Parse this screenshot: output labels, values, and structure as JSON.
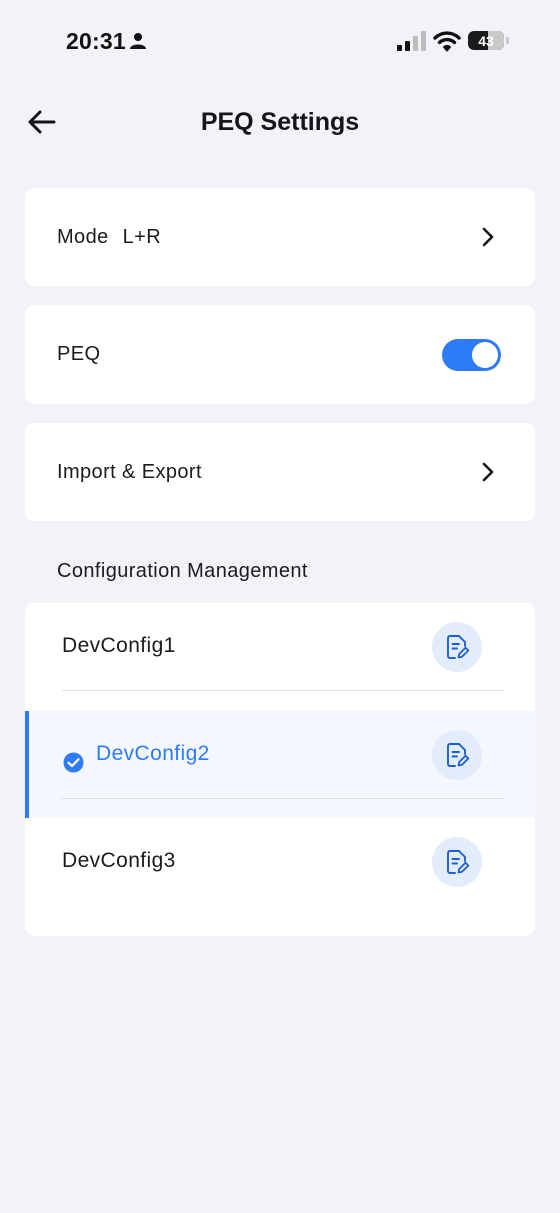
{
  "status_bar": {
    "time": "20:31",
    "battery": "43",
    "icons": [
      "person-icon",
      "signal-icon",
      "wifi-icon",
      "battery-icon"
    ]
  },
  "header": {
    "title": "PEQ Settings",
    "back_icon": "arrow-left-icon"
  },
  "mode_row": {
    "label": "Mode",
    "value": "L+R"
  },
  "peq_row": {
    "label": "PEQ",
    "enabled": true
  },
  "import_row": {
    "label": "Import & Export"
  },
  "config_section": {
    "title": "Configuration Management",
    "items": [
      {
        "name": "DevConfig1",
        "selected": false
      },
      {
        "name": "DevConfig2",
        "selected": true
      },
      {
        "name": "DevConfig3",
        "selected": false
      }
    ]
  },
  "colors": {
    "accent": "#2D7CF6",
    "background": "#F1F3F8",
    "card": "#FFFFFF",
    "selected_row": "#F4F7FD",
    "edit_button_bg": "#E3ECFB"
  }
}
